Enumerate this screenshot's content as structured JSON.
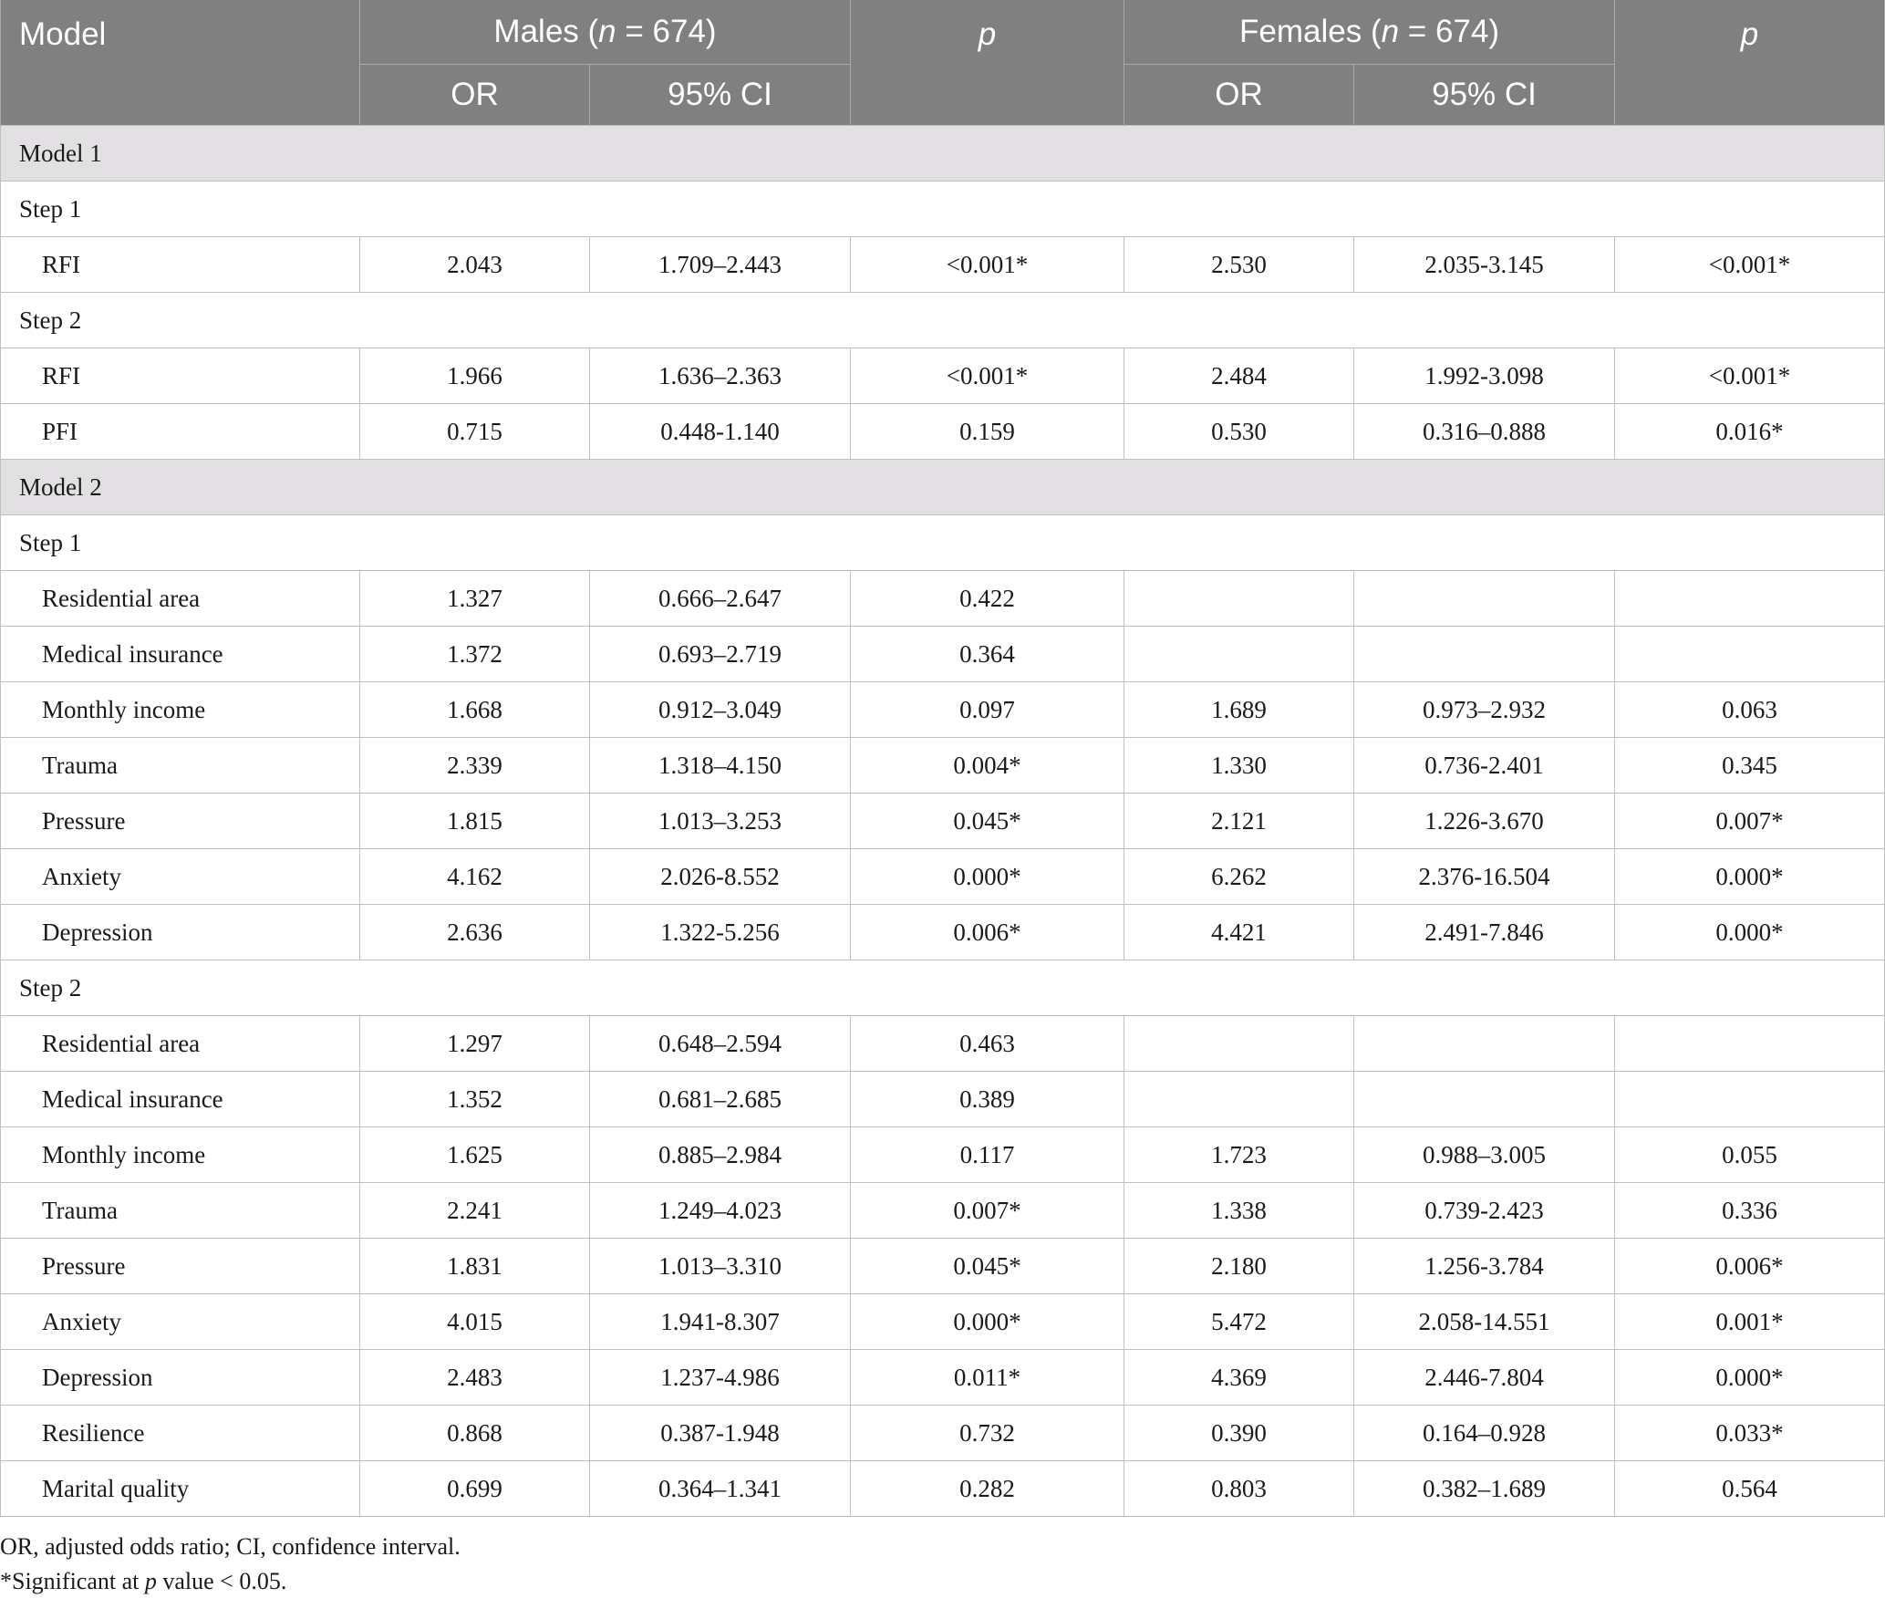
{
  "header": {
    "model": "Model",
    "males_group": "Males (",
    "males_n_var": "n",
    "males_n_rest": " = 674)",
    "females_group": "Females (",
    "females_n_var": "n",
    "females_n_rest": " = 674)",
    "p": "p",
    "or": "OR",
    "ci": "95% CI"
  },
  "model1": {
    "label": "Model 1",
    "step1": {
      "label": "Step 1",
      "rows": [
        {
          "name": "RFI",
          "m_or": "2.043",
          "m_ci": "1.709–2.443",
          "m_p": "<0.001*",
          "f_or": "2.530",
          "f_ci": "2.035-3.145",
          "f_p": "<0.001*"
        }
      ]
    },
    "step2": {
      "label": "Step 2",
      "rows": [
        {
          "name": "RFI",
          "m_or": "1.966",
          "m_ci": "1.636–2.363",
          "m_p": "<0.001*",
          "f_or": "2.484",
          "f_ci": "1.992-3.098",
          "f_p": "<0.001*"
        },
        {
          "name": "PFI",
          "m_or": "0.715",
          "m_ci": "0.448-1.140",
          "m_p": "0.159",
          "f_or": "0.530",
          "f_ci": "0.316–0.888",
          "f_p": "0.016*"
        }
      ]
    }
  },
  "model2": {
    "label": "Model 2",
    "step1": {
      "label": "Step 1",
      "rows": [
        {
          "name": "Residential area",
          "m_or": "1.327",
          "m_ci": "0.666–2.647",
          "m_p": "0.422",
          "f_or": "",
          "f_ci": "",
          "f_p": ""
        },
        {
          "name": "Medical insurance",
          "m_or": "1.372",
          "m_ci": "0.693–2.719",
          "m_p": "0.364",
          "f_or": "",
          "f_ci": "",
          "f_p": ""
        },
        {
          "name": "Monthly income",
          "m_or": "1.668",
          "m_ci": "0.912–3.049",
          "m_p": "0.097",
          "f_or": "1.689",
          "f_ci": "0.973–2.932",
          "f_p": "0.063"
        },
        {
          "name": "Trauma",
          "m_or": "2.339",
          "m_ci": "1.318–4.150",
          "m_p": "0.004*",
          "f_or": "1.330",
          "f_ci": "0.736-2.401",
          "f_p": "0.345"
        },
        {
          "name": "Pressure",
          "m_or": "1.815",
          "m_ci": "1.013–3.253",
          "m_p": "0.045*",
          "f_or": "2.121",
          "f_ci": "1.226-3.670",
          "f_p": "0.007*"
        },
        {
          "name": "Anxiety",
          "m_or": "4.162",
          "m_ci": "2.026-8.552",
          "m_p": "0.000*",
          "f_or": "6.262",
          "f_ci": "2.376-16.504",
          "f_p": "0.000*"
        },
        {
          "name": "Depression",
          "m_or": "2.636",
          "m_ci": "1.322-5.256",
          "m_p": "0.006*",
          "f_or": "4.421",
          "f_ci": "2.491-7.846",
          "f_p": "0.000*"
        }
      ]
    },
    "step2": {
      "label": "Step 2",
      "rows": [
        {
          "name": "Residential area",
          "m_or": "1.297",
          "m_ci": "0.648–2.594",
          "m_p": "0.463",
          "f_or": "",
          "f_ci": "",
          "f_p": ""
        },
        {
          "name": "Medical insurance",
          "m_or": "1.352",
          "m_ci": "0.681–2.685",
          "m_p": "0.389",
          "f_or": "",
          "f_ci": "",
          "f_p": ""
        },
        {
          "name": "Monthly income",
          "m_or": "1.625",
          "m_ci": "0.885–2.984",
          "m_p": "0.117",
          "f_or": "1.723",
          "f_ci": "0.988–3.005",
          "f_p": "0.055"
        },
        {
          "name": "Trauma",
          "m_or": "2.241",
          "m_ci": "1.249–4.023",
          "m_p": "0.007*",
          "f_or": "1.338",
          "f_ci": "0.739-2.423",
          "f_p": "0.336"
        },
        {
          "name": "Pressure",
          "m_or": "1.831",
          "m_ci": "1.013–3.310",
          "m_p": "0.045*",
          "f_or": "2.180",
          "f_ci": "1.256-3.784",
          "f_p": "0.006*"
        },
        {
          "name": "Anxiety",
          "m_or": "4.015",
          "m_ci": "1.941-8.307",
          "m_p": "0.000*",
          "f_or": "5.472",
          "f_ci": "2.058-14.551",
          "f_p": "0.001*"
        },
        {
          "name": "Depression",
          "m_or": "2.483",
          "m_ci": "1.237-4.986",
          "m_p": "0.011*",
          "f_or": "4.369",
          "f_ci": "2.446-7.804",
          "f_p": "0.000*"
        },
        {
          "name": "Resilience",
          "m_or": "0.868",
          "m_ci": "0.387-1.948",
          "m_p": "0.732",
          "f_or": "0.390",
          "f_ci": "0.164–0.928",
          "f_p": "0.033*"
        },
        {
          "name": "Marital quality",
          "m_or": "0.699",
          "m_ci": "0.364–1.341",
          "m_p": "0.282",
          "f_or": "0.803",
          "f_ci": "0.382–1.689",
          "f_p": "0.564"
        }
      ]
    }
  },
  "footnotes": {
    "line1": "OR, adjusted odds ratio; CI, confidence interval.",
    "line2_pre": "*Significant at ",
    "line2_var": "p",
    "line2_post": " value < 0.05."
  }
}
